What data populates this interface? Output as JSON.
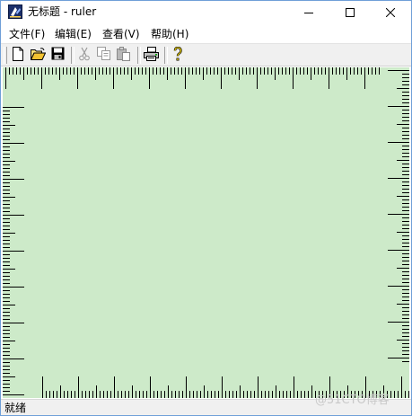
{
  "window": {
    "title": "无标题 - ruler",
    "icon": "app-ruler-icon"
  },
  "caption_buttons": {
    "minimize": "minimize-icon",
    "maximize": "maximize-icon",
    "close": "close-icon"
  },
  "menu": {
    "items": [
      {
        "label": "文件(F)"
      },
      {
        "label": "编辑(E)"
      },
      {
        "label": "查看(V)"
      },
      {
        "label": "帮助(H)"
      }
    ]
  },
  "toolbar": {
    "buttons": [
      {
        "icon": "new-file-icon",
        "enabled": true
      },
      {
        "icon": "open-folder-icon",
        "enabled": true
      },
      {
        "icon": "save-disk-icon",
        "enabled": true
      },
      {
        "icon": "cut-icon",
        "enabled": false
      },
      {
        "icon": "copy-icon",
        "enabled": false
      },
      {
        "icon": "paste-icon",
        "enabled": false
      },
      {
        "icon": "print-icon",
        "enabled": true
      },
      {
        "icon": "help-icon",
        "enabled": true
      }
    ]
  },
  "canvas": {
    "background": "#cdeac9",
    "tick_color": "#000000"
  },
  "status": {
    "text": "就绪"
  },
  "watermark": {
    "text": "@51CTO博客"
  }
}
